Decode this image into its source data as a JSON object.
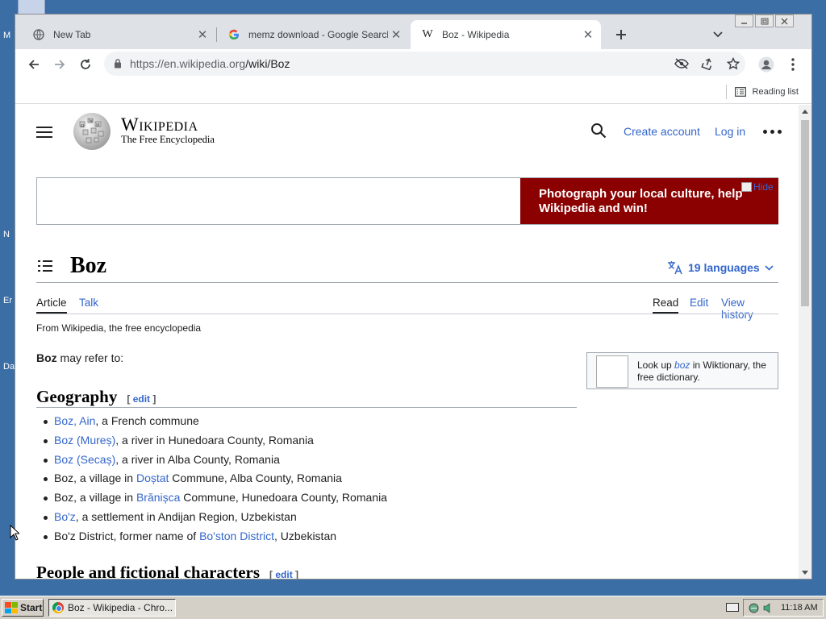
{
  "desktop": {
    "icon_labels": [
      "M",
      "N",
      "Er",
      "Da"
    ]
  },
  "browser": {
    "tabs": [
      {
        "title": "New Tab",
        "icon": "globe-icon",
        "active": false
      },
      {
        "title": "memz download - Google Search",
        "icon": "google-icon",
        "active": false
      },
      {
        "title": "Boz - Wikipedia",
        "icon": "wikipedia-icon",
        "active": true
      }
    ],
    "url_domain": "https://en.wikipedia.org",
    "url_path": "/wiki/Boz",
    "reading_list": "Reading list"
  },
  "wiki": {
    "wordmark": "Wikipedia",
    "tagline": "The Free Encyclopedia",
    "create_account": "Create account",
    "log_in": "Log in",
    "banner_text": "Photograph your local culture, help Wikipedia and win!",
    "banner_hide": "Hide",
    "title": "Boz",
    "languages": "19 languages",
    "tabs": {
      "article": "Article",
      "talk": "Talk",
      "read": "Read",
      "edit": "Edit",
      "history": "View history"
    },
    "from": "From Wikipedia, the free encyclopedia",
    "intro_bold": "Boz",
    "intro_rest": " may refer to:",
    "wiktionary": {
      "pre": "Look up ",
      "word": "boz",
      "post": " in Wiktionary, the free dictionary."
    },
    "section1": "Geography",
    "edit_label": "edit",
    "geo_items": [
      {
        "link": "Boz, Ain",
        "pre": "",
        "post": ", a French commune"
      },
      {
        "link": "Boz (Mureș)",
        "pre": "",
        "post": ", a river in Hunedoara County, Romania"
      },
      {
        "link": "Boz (Secaș)",
        "pre": "",
        "post": ", a river in Alba County, Romania"
      },
      {
        "link": "Doștat",
        "pre": "Boz, a village in ",
        "post": " Commune, Alba County, Romania"
      },
      {
        "link": "Brănișca",
        "pre": "Boz, a village in ",
        "post": " Commune, Hunedoara County, Romania"
      },
      {
        "link": "Bo'z",
        "pre": "",
        "post": ", a settlement in Andijan Region, Uzbekistan"
      },
      {
        "link": "Bo'ston District",
        "pre": "Bo'z District, former name of ",
        "post": ", Uzbekistan"
      }
    ],
    "section2": "People and fictional characters"
  },
  "taskbar": {
    "start": "Start",
    "task_title": "Boz - Wikipedia - Chro...",
    "clock": "11:18 AM"
  },
  "colors": {
    "desktop": "#3a6ea5",
    "link": "#3366cc",
    "banner": "#8b0000"
  }
}
